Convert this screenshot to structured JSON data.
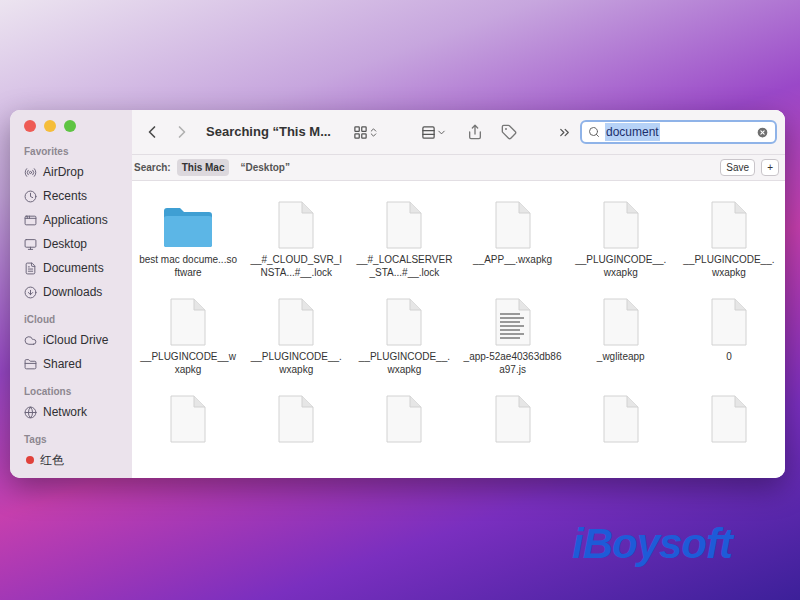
{
  "window": {
    "title": "Searching “This M..."
  },
  "sidebar": {
    "sections": [
      {
        "header": "Favorites",
        "items": [
          {
            "label": "AirDrop",
            "kind": "place",
            "selected": false
          },
          {
            "label": "Recents",
            "kind": "place",
            "selected": false
          },
          {
            "label": "Applications",
            "kind": "place",
            "selected": false
          },
          {
            "label": "Desktop",
            "kind": "place",
            "selected": false
          },
          {
            "label": "Documents",
            "kind": "place",
            "selected": false
          },
          {
            "label": "Downloads",
            "kind": "place",
            "selected": false
          }
        ]
      },
      {
        "header": "iCloud",
        "items": [
          {
            "label": "iCloud Drive",
            "kind": "place",
            "selected": false
          },
          {
            "label": "Shared",
            "kind": "place",
            "selected": false
          }
        ]
      },
      {
        "header": "Locations",
        "items": [
          {
            "label": "Network",
            "kind": "place",
            "selected": false
          }
        ]
      },
      {
        "header": "Tags",
        "items": [
          {
            "label": "红色",
            "kind": "tag",
            "selected": false,
            "color": "#e0413b"
          }
        ]
      }
    ]
  },
  "search": {
    "query": "document",
    "selected": true
  },
  "scope": {
    "label": "Search:",
    "options": [
      {
        "label": "This Mac",
        "selected": true
      },
      {
        "label": "“Desktop”",
        "selected": false
      }
    ],
    "buttons": [
      "Save",
      "+"
    ]
  },
  "files": [
    {
      "name": "best mac docume...software",
      "kind": "folder"
    },
    {
      "name": "__#_CLOUD_SVR_INSTA...#__.lock",
      "kind": "document"
    },
    {
      "name": "__#_LOCALSERVER_STA...#__.lock",
      "kind": "document"
    },
    {
      "name": "__APP__.wxapkg",
      "kind": "document"
    },
    {
      "name": "__PLUGINCODE__.wxapkg",
      "kind": "document"
    },
    {
      "name": "__PLUGINCODE__.wxapkg",
      "kind": "document"
    },
    {
      "name": "__PLUGINCODE__wxapkg",
      "kind": "document"
    },
    {
      "name": "__PLUGINCODE__.wxapkg",
      "kind": "document"
    },
    {
      "name": "__PLUGINCODE__.wxapkg",
      "kind": "document"
    },
    {
      "name": "_app-52ae40363db86a97.js",
      "kind": "script"
    },
    {
      "name": "_wgliteapp",
      "kind": "document"
    },
    {
      "name": "0",
      "kind": "document"
    },
    {
      "name": "",
      "kind": "document"
    },
    {
      "name": "",
      "kind": "document"
    },
    {
      "name": "",
      "kind": "document"
    },
    {
      "name": "",
      "kind": "document"
    },
    {
      "name": "",
      "kind": "document"
    },
    {
      "name": "",
      "kind": "document"
    }
  ],
  "watermark": "iBoysoft"
}
